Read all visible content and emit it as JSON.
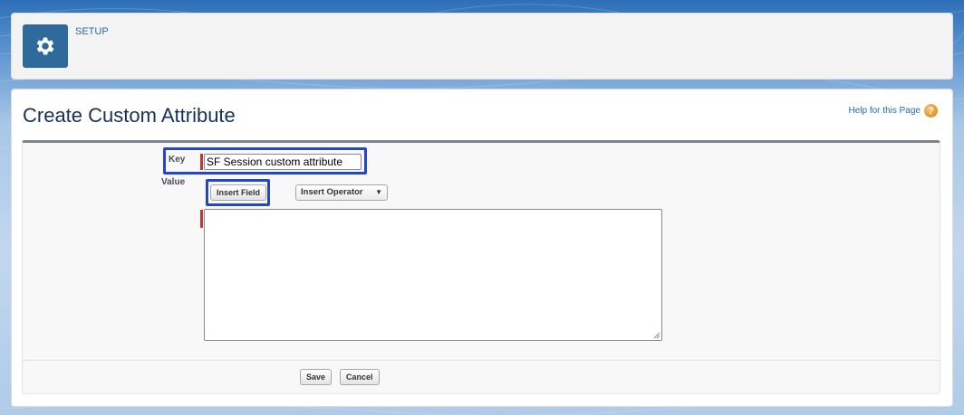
{
  "header": {
    "setup_label": "SETUP",
    "icon": "gear-icon"
  },
  "page": {
    "title": "Create Custom Attribute",
    "help_link": "Help for this Page",
    "help_icon": "question-icon"
  },
  "form": {
    "key_label": "Key",
    "key_value": "SF Session custom attribute",
    "value_label": "Value",
    "insert_field_label": "Insert Field",
    "insert_operator_label": "Insert Operator",
    "value_text": ""
  },
  "footer": {
    "save_label": "Save",
    "cancel_label": "Cancel"
  },
  "colors": {
    "highlight": "#2447c9",
    "required": "#c23934",
    "setup_tile": "#2e6a9c"
  }
}
